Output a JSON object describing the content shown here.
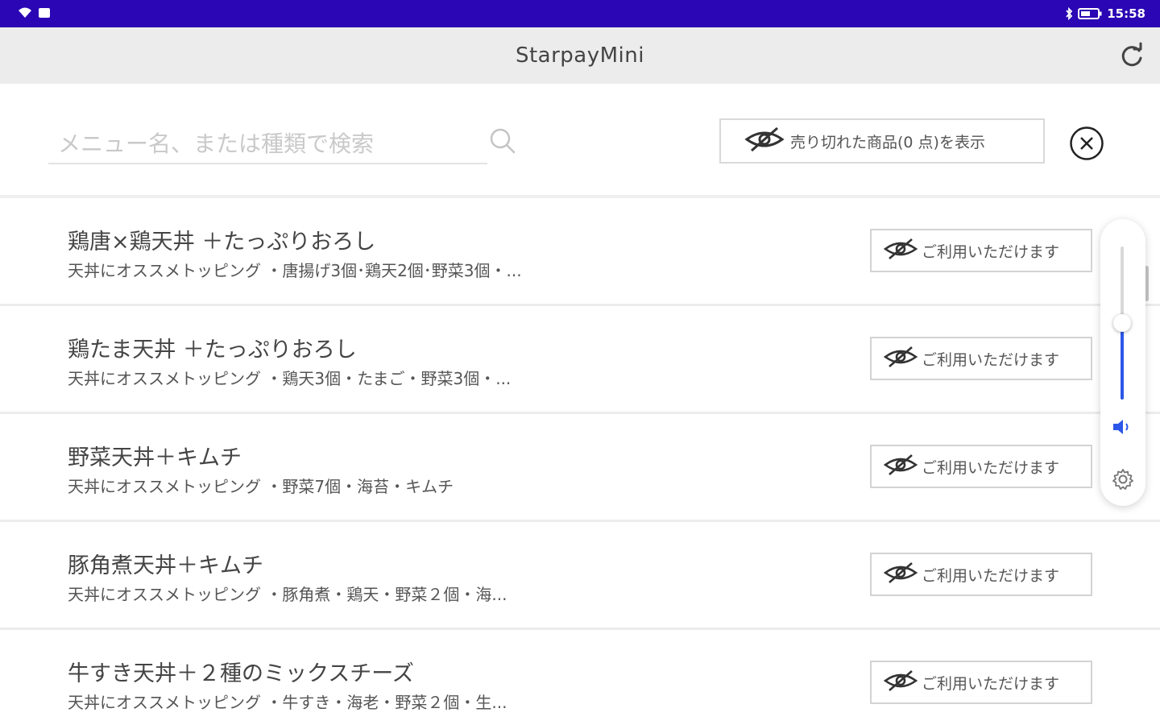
{
  "status_bar": {
    "time": "15:58",
    "icons": [
      "wifi-icon",
      "sim-icon",
      "bluetooth-icon",
      "battery-icon"
    ],
    "color": "#2a06b4"
  },
  "app_bar": {
    "title": "StarpayMini",
    "refresh_icon": "refresh-icon"
  },
  "search": {
    "placeholder": "メニュー名、または種類で検索"
  },
  "show_soldout": {
    "label": "売り切れた商品(0 点)を表示"
  },
  "menu_items": [
    {
      "name": "鶏唐×鶏天丼 ＋たっぷりおろし",
      "description": "天丼にオススメトッピング ・唐揚げ3個･鶏天2個･野菜3個・...",
      "status_label": "ご利用いただけます"
    },
    {
      "name": "鶏たま天丼 ＋たっぷりおろし",
      "description": "天丼にオススメトッピング ・鶏天3個・たまご・野菜3個・...",
      "status_label": "ご利用いただけます"
    },
    {
      "name": "野菜天丼＋キムチ",
      "description": "天丼にオススメトッピング ・野菜7個・海苔・キムチ",
      "status_label": "ご利用いただけます"
    },
    {
      "name": "豚角煮天丼＋キムチ",
      "description": "天丼にオススメトッピング ・豚角煮・鶏天・野菜２個・海...",
      "status_label": "ご利用いただけます"
    },
    {
      "name": "牛すき天丼＋２種のミックスチーズ",
      "description": "天丼にオススメトッピング ・牛すき・海老・野菜２個・生...",
      "status_label": "ご利用いただけます"
    }
  ],
  "volume": {
    "level": 0.5,
    "accent_color": "#2d57e8"
  }
}
